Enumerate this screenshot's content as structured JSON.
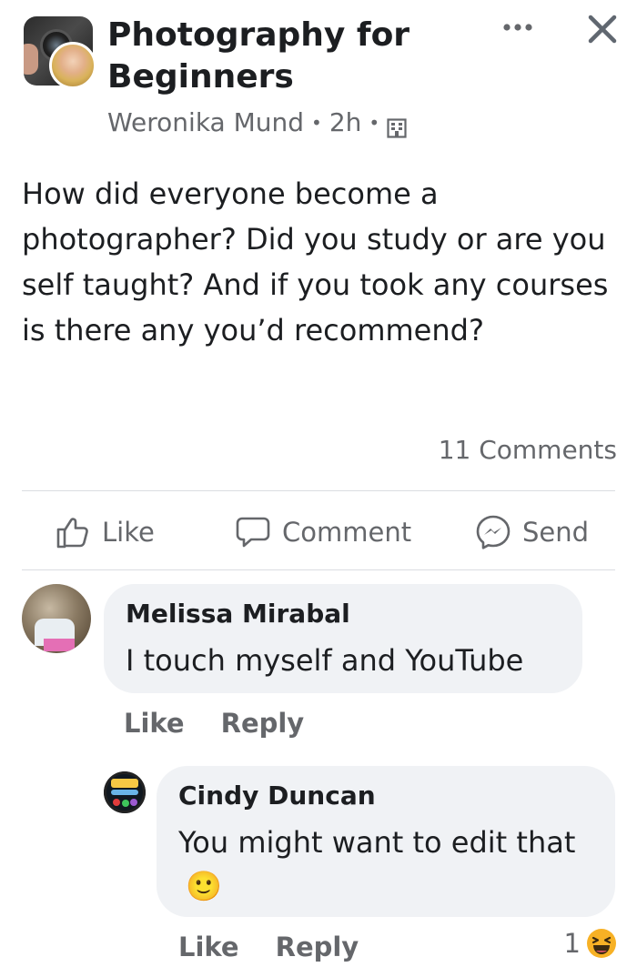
{
  "post": {
    "group_name": "Photography for Beginners",
    "author": "Weronika Mund",
    "time": "2h",
    "separator": "•",
    "text": "How did everyone become a photographer? Did you study or are you self taught? And if you took any courses is there any you’d recommend?",
    "comments_count": "11 Comments"
  },
  "actions": {
    "like": "Like",
    "comment": "Comment",
    "send": "Send"
  },
  "comments": [
    {
      "name": "Melissa Mirabal",
      "text": "I touch myself and YouTube",
      "like": "Like",
      "reply": "Reply"
    },
    {
      "name": "Cindy Duncan",
      "text": "You might want to edit that",
      "emoji": "🙂",
      "like": "Like",
      "reply": "Reply",
      "reaction_count": "1"
    }
  ],
  "colors": {
    "text": "#1c1e21",
    "secondary": "#65676b",
    "bubble": "#f0f2f5",
    "divider": "#dadde1",
    "haha": "#f7b125"
  },
  "icons": {
    "more": "more-options-icon",
    "close": "close-icon",
    "privacy": "group-privacy-icon",
    "like": "thumbs-up-icon",
    "comment": "comment-bubble-icon",
    "send": "messenger-icon",
    "reaction": "haha-reaction-icon"
  }
}
